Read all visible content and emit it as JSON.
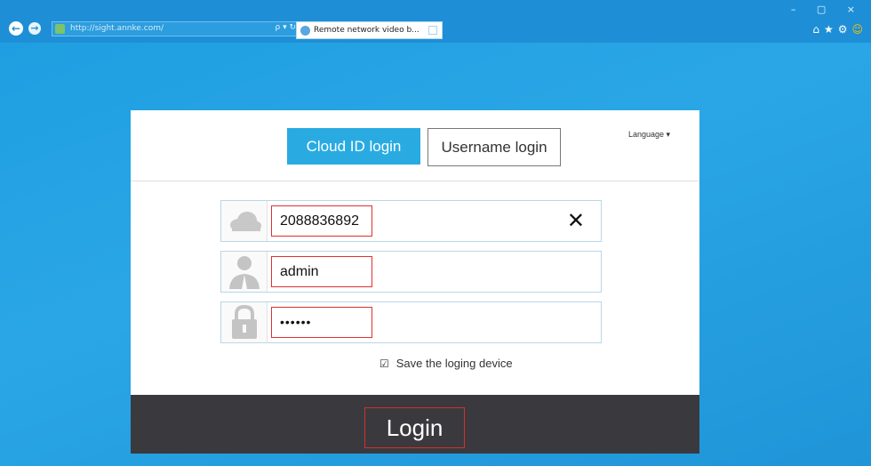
{
  "browser": {
    "url": "http://sight.annke.com/",
    "address_controls": "ρ ▾ ↻",
    "tab_title": "Remote network video b...",
    "tab_close": "×",
    "window_controls": "– ▢ ×",
    "toolbar_icons": [
      "⌂",
      "★",
      "⚙",
      "☺"
    ],
    "back_glyph": "←",
    "forward_glyph": "→"
  },
  "login": {
    "tabs": [
      {
        "label": "Cloud ID login",
        "active": true
      },
      {
        "label": "Username login",
        "active": false
      }
    ],
    "language_label": "Language ▾",
    "fields": {
      "cloud_id": {
        "value": "2088836892",
        "icon": "cloud-icon",
        "clear": "✕"
      },
      "username": {
        "value": "admin",
        "icon": "user-icon"
      },
      "password": {
        "value": "••••••",
        "icon": "lock-icon"
      }
    },
    "remember": {
      "check": "☑",
      "label": "Save the loging device",
      "checked": true
    },
    "submit_label": "Login"
  },
  "colors": {
    "accent": "#29abe2",
    "background": "#1d9ee0",
    "login_bar": "#3a3a3e",
    "highlight": "#e03030"
  }
}
